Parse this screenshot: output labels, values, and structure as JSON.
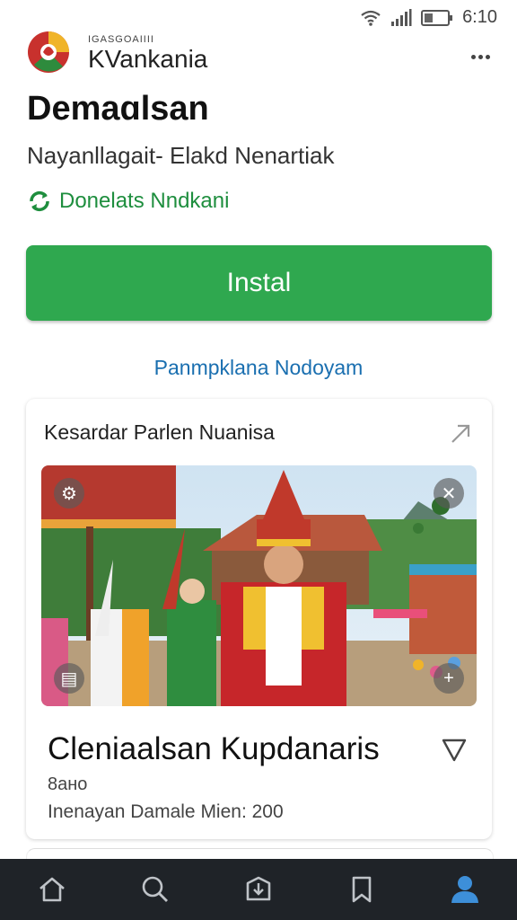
{
  "status": {
    "time": "6:10",
    "icons": [
      "wifi-icon",
      "signal-icon",
      "battery-icon"
    ]
  },
  "header": {
    "brand_small": "IGASGOAIIII",
    "brand": "KVankania",
    "menu_icon": "more-vert-icon"
  },
  "app": {
    "title": "Demaɑlsan",
    "subtitle": "Nayanllagait- Elakd Nenartiak",
    "developer": "Donelats Nndkani",
    "install_label": "Instal",
    "link_label": "Panmpklana Nodoyam"
  },
  "card": {
    "heading": "Kesardar Parlen Nuanisa",
    "item_title": "Cleniaalsan Kupdanaris",
    "price": "8ано",
    "meta": "Inenayan Damale Mien: 200"
  },
  "nav": {
    "items": [
      "home-icon",
      "search-icon",
      "apps-icon",
      "bookmark-icon",
      "profile-icon"
    ]
  },
  "colors": {
    "install": "#2fa84f",
    "developer": "#1e8e3e",
    "link": "#1a6fb0",
    "nav_bg": "#1f2328",
    "nav_active": "#3d8fd9"
  }
}
